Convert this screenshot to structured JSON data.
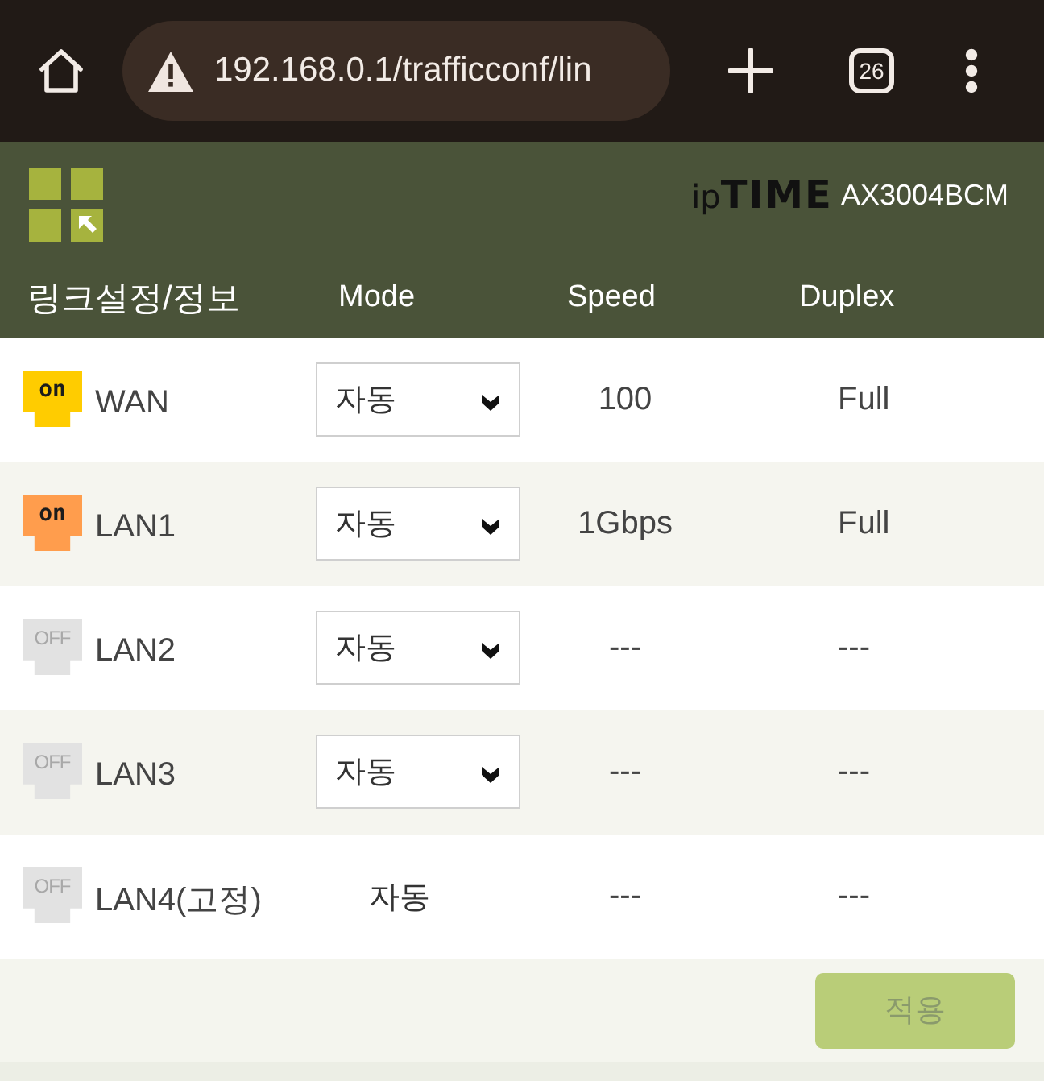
{
  "browser": {
    "url": "192.168.0.1/trafficconf/lin",
    "tab_count": "26"
  },
  "header": {
    "brand": "ip**TIME**",
    "model": "AX3004BCM"
  },
  "table": {
    "columns": [
      "링크설정/정보",
      "Mode",
      "Speed",
      "Duplex"
    ],
    "rows": [
      {
        "status": "on",
        "connected": true,
        "color": "#ffcc00",
        "name": "WAN",
        "mode": {
          "kind": "select",
          "value": "자동"
        },
        "speed": "100",
        "duplex": "Full"
      },
      {
        "status": "on",
        "connected": true,
        "color": "#ff9d4d",
        "name": "LAN1",
        "mode": {
          "kind": "select",
          "value": "자동"
        },
        "speed": "1Gbps",
        "duplex": "Full"
      },
      {
        "status": "OFF",
        "connected": false,
        "color": "#e2e2e2",
        "name": "LAN2",
        "mode": {
          "kind": "select",
          "value": "자동"
        },
        "speed": "---",
        "duplex": "---"
      },
      {
        "status": "OFF",
        "connected": false,
        "color": "#e2e2e2",
        "name": "LAN3",
        "mode": {
          "kind": "select",
          "value": "자동"
        },
        "speed": "---",
        "duplex": "---"
      },
      {
        "status": "OFF",
        "connected": false,
        "color": "#e2e2e2",
        "name": "LAN4(고정)",
        "mode": {
          "kind": "text",
          "value": "자동"
        },
        "speed": "---",
        "duplex": "---"
      }
    ]
  },
  "apply_button": {
    "label": "적용",
    "disabled": true
  }
}
